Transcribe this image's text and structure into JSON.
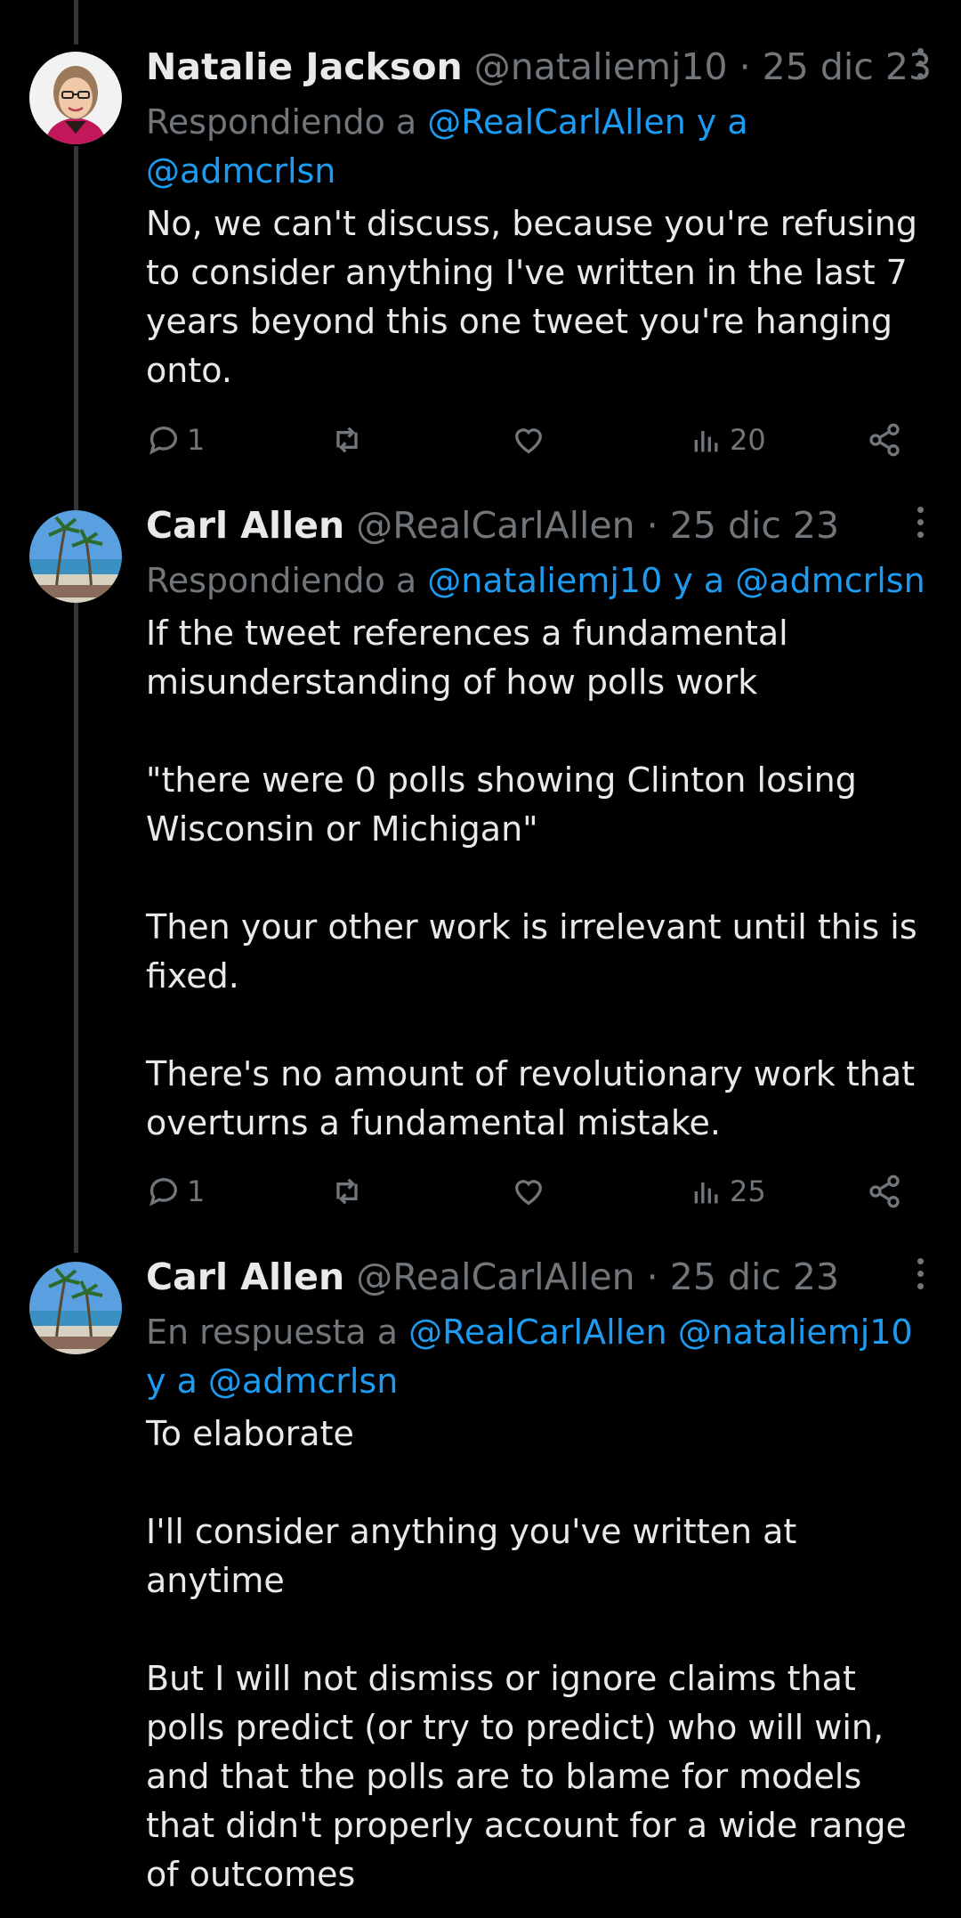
{
  "tweets": [
    {
      "name": "Natalie Jackson",
      "handle": "@nataliemj10",
      "date": "25 dic 23",
      "reply_prefix": "Respondiendo a ",
      "reply_mentions": "@RealCarlAllen y a @admcrlsn",
      "text": "No, we can't discuss, because you're refusing to consider anything I've written in the last 7 years beyond this one tweet you're hanging onto.",
      "replies": "1",
      "views": "20",
      "avatar_icon": "profile-photo-woman-glasses"
    },
    {
      "name": "Carl Allen",
      "handle": "@RealCarlAllen",
      "date": "25 dic 23",
      "reply_prefix": "Respondiendo a ",
      "reply_mentions": "@nataliemj10 y a @admcrlsn",
      "text": "If the tweet references a fundamental misunderstanding of how polls work\n\n\"there were 0 polls showing Clinton losing Wisconsin or Michigan\"\n\nThen your other work is irrelevant until this is fixed.\n\nThere's no amount of revolutionary work that overturns a fundamental mistake.",
      "replies": "1",
      "views": "25",
      "avatar_icon": "profile-photo-beach-palms"
    },
    {
      "name": "Carl Allen",
      "handle": "@RealCarlAllen",
      "date": "25 dic 23",
      "reply_prefix": "En respuesta a ",
      "reply_mentions": "@RealCarlAllen @nataliemj10 y a @admcrlsn",
      "text": "To elaborate\n\nI'll consider anything you've written at anytime\n\nBut I will not dismiss or ignore claims that polls predict (or try to predict) who will win, and that the polls are to blame for models that didn't properly account for a wide range of outcomes",
      "avatar_icon": "profile-photo-beach-palms"
    }
  ],
  "separator": " · ",
  "colors": {
    "background": "#000000",
    "text": "#e7e9ea",
    "muted": "#71767b",
    "link": "#1d9bf0",
    "thread_line": "#333639"
  },
  "action_icons": [
    "reply-icon",
    "retweet-icon",
    "like-icon",
    "views-icon",
    "share-icon"
  ]
}
